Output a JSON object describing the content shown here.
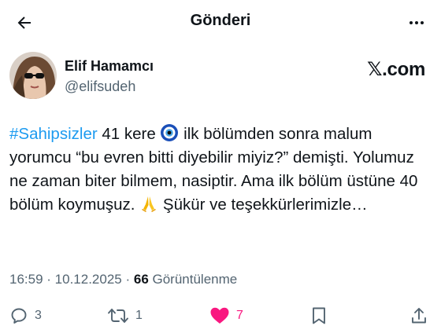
{
  "header": {
    "title": "Gönderi"
  },
  "author": {
    "display_name": "Elif Hamamcı",
    "handle": "@elifsudeh"
  },
  "source_label": "𝕏.com",
  "tweet": {
    "hashtag": "#Sahipsizler",
    "line1_after_hashtag": " 41 kere ",
    "line1_after_emoji": " ilk bölümden sonra malum",
    "body_mid": "yorumcu “bu evren bitti diyebilir miyiz?” demişti. Yolumuz ne zaman biter bilmem, nasiptir. Ama ilk bölüm üstüne 40 bölüm koymuşuz. ",
    "body_end": " Şükür ve teşekkürlerimizle…",
    "emoji_1": "nazar-boncugu-icon",
    "emoji_2": "folded-hands-icon"
  },
  "meta": {
    "time": "16:59",
    "separator": " · ",
    "date": "10.12.2025",
    "views_count": "66",
    "views_label": " Görüntülenme"
  },
  "actions": {
    "replies": "3",
    "reposts": "1",
    "likes": "7",
    "liked": true
  },
  "colors": {
    "accent": "#1d9bf0",
    "like": "#f91880",
    "muted": "#536471",
    "text": "#0f1419"
  }
}
